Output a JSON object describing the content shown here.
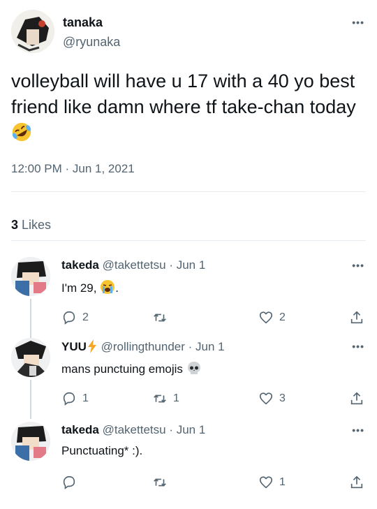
{
  "main_tweet": {
    "name": "tanaka",
    "handle": "@ryunaka",
    "text": "volleyball will have u 17 with a 40 yo best friend like damn where tf take-chan today",
    "emoji": "rolling-on-floor-laughing-emoji",
    "timestamp": "12:00 PM · Jun 1, 2021",
    "likes_count": "3",
    "likes_label": "Likes"
  },
  "replies": [
    {
      "name": "takeda",
      "handle": "@takettetsu",
      "date": "· Jun 1",
      "text": "I'm 29, ",
      "text_suffix": ".",
      "emoji": "loudly-crying-emoji",
      "reply_count": "2",
      "retweet_count": "",
      "like_count": "2"
    },
    {
      "name": "YUU",
      "name_emoji": "lightning-emoji",
      "handle": "@rollingthunder",
      "date": "· Jun 1",
      "text": "mans punctuing emojis ",
      "emoji": "skull-emoji",
      "reply_count": "1",
      "retweet_count": "1",
      "like_count": "3"
    },
    {
      "name": "takeda",
      "handle": "@takettetsu",
      "date": "· Jun 1",
      "text": "Punctuating* :).",
      "reply_count": "",
      "retweet_count": "",
      "like_count": "1"
    }
  ],
  "colors": {
    "text": "#0f1419",
    "secondary": "#536471",
    "divider": "#e6ecf0",
    "thread_line": "#cfd9de",
    "accent_lightning": "#f6a623"
  }
}
